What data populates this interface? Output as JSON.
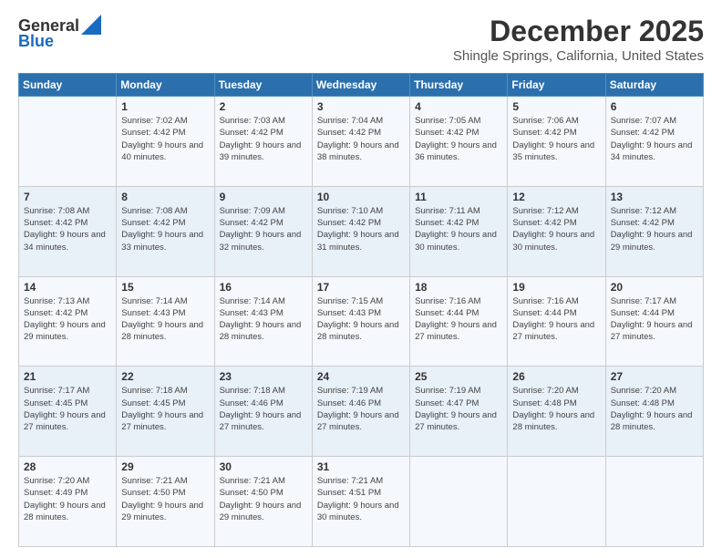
{
  "header": {
    "logo_general": "General",
    "logo_blue": "Blue",
    "main_title": "December 2025",
    "subtitle": "Shingle Springs, California, United States"
  },
  "calendar": {
    "days_of_week": [
      "Sunday",
      "Monday",
      "Tuesday",
      "Wednesday",
      "Thursday",
      "Friday",
      "Saturday"
    ],
    "weeks": [
      [
        {
          "day": "",
          "sunrise": "",
          "sunset": "",
          "daylight": ""
        },
        {
          "day": "1",
          "sunrise": "Sunrise: 7:02 AM",
          "sunset": "Sunset: 4:42 PM",
          "daylight": "Daylight: 9 hours and 40 minutes."
        },
        {
          "day": "2",
          "sunrise": "Sunrise: 7:03 AM",
          "sunset": "Sunset: 4:42 PM",
          "daylight": "Daylight: 9 hours and 39 minutes."
        },
        {
          "day": "3",
          "sunrise": "Sunrise: 7:04 AM",
          "sunset": "Sunset: 4:42 PM",
          "daylight": "Daylight: 9 hours and 38 minutes."
        },
        {
          "day": "4",
          "sunrise": "Sunrise: 7:05 AM",
          "sunset": "Sunset: 4:42 PM",
          "daylight": "Daylight: 9 hours and 36 minutes."
        },
        {
          "day": "5",
          "sunrise": "Sunrise: 7:06 AM",
          "sunset": "Sunset: 4:42 PM",
          "daylight": "Daylight: 9 hours and 35 minutes."
        },
        {
          "day": "6",
          "sunrise": "Sunrise: 7:07 AM",
          "sunset": "Sunset: 4:42 PM",
          "daylight": "Daylight: 9 hours and 34 minutes."
        }
      ],
      [
        {
          "day": "7",
          "sunrise": "Sunrise: 7:08 AM",
          "sunset": "Sunset: 4:42 PM",
          "daylight": "Daylight: 9 hours and 34 minutes."
        },
        {
          "day": "8",
          "sunrise": "Sunrise: 7:08 AM",
          "sunset": "Sunset: 4:42 PM",
          "daylight": "Daylight: 9 hours and 33 minutes."
        },
        {
          "day": "9",
          "sunrise": "Sunrise: 7:09 AM",
          "sunset": "Sunset: 4:42 PM",
          "daylight": "Daylight: 9 hours and 32 minutes."
        },
        {
          "day": "10",
          "sunrise": "Sunrise: 7:10 AM",
          "sunset": "Sunset: 4:42 PM",
          "daylight": "Daylight: 9 hours and 31 minutes."
        },
        {
          "day": "11",
          "sunrise": "Sunrise: 7:11 AM",
          "sunset": "Sunset: 4:42 PM",
          "daylight": "Daylight: 9 hours and 30 minutes."
        },
        {
          "day": "12",
          "sunrise": "Sunrise: 7:12 AM",
          "sunset": "Sunset: 4:42 PM",
          "daylight": "Daylight: 9 hours and 30 minutes."
        },
        {
          "day": "13",
          "sunrise": "Sunrise: 7:12 AM",
          "sunset": "Sunset: 4:42 PM",
          "daylight": "Daylight: 9 hours and 29 minutes."
        }
      ],
      [
        {
          "day": "14",
          "sunrise": "Sunrise: 7:13 AM",
          "sunset": "Sunset: 4:42 PM",
          "daylight": "Daylight: 9 hours and 29 minutes."
        },
        {
          "day": "15",
          "sunrise": "Sunrise: 7:14 AM",
          "sunset": "Sunset: 4:43 PM",
          "daylight": "Daylight: 9 hours and 28 minutes."
        },
        {
          "day": "16",
          "sunrise": "Sunrise: 7:14 AM",
          "sunset": "Sunset: 4:43 PM",
          "daylight": "Daylight: 9 hours and 28 minutes."
        },
        {
          "day": "17",
          "sunrise": "Sunrise: 7:15 AM",
          "sunset": "Sunset: 4:43 PM",
          "daylight": "Daylight: 9 hours and 28 minutes."
        },
        {
          "day": "18",
          "sunrise": "Sunrise: 7:16 AM",
          "sunset": "Sunset: 4:44 PM",
          "daylight": "Daylight: 9 hours and 27 minutes."
        },
        {
          "day": "19",
          "sunrise": "Sunrise: 7:16 AM",
          "sunset": "Sunset: 4:44 PM",
          "daylight": "Daylight: 9 hours and 27 minutes."
        },
        {
          "day": "20",
          "sunrise": "Sunrise: 7:17 AM",
          "sunset": "Sunset: 4:44 PM",
          "daylight": "Daylight: 9 hours and 27 minutes."
        }
      ],
      [
        {
          "day": "21",
          "sunrise": "Sunrise: 7:17 AM",
          "sunset": "Sunset: 4:45 PM",
          "daylight": "Daylight: 9 hours and 27 minutes."
        },
        {
          "day": "22",
          "sunrise": "Sunrise: 7:18 AM",
          "sunset": "Sunset: 4:45 PM",
          "daylight": "Daylight: 9 hours and 27 minutes."
        },
        {
          "day": "23",
          "sunrise": "Sunrise: 7:18 AM",
          "sunset": "Sunset: 4:46 PM",
          "daylight": "Daylight: 9 hours and 27 minutes."
        },
        {
          "day": "24",
          "sunrise": "Sunrise: 7:19 AM",
          "sunset": "Sunset: 4:46 PM",
          "daylight": "Daylight: 9 hours and 27 minutes."
        },
        {
          "day": "25",
          "sunrise": "Sunrise: 7:19 AM",
          "sunset": "Sunset: 4:47 PM",
          "daylight": "Daylight: 9 hours and 27 minutes."
        },
        {
          "day": "26",
          "sunrise": "Sunrise: 7:20 AM",
          "sunset": "Sunset: 4:48 PM",
          "daylight": "Daylight: 9 hours and 28 minutes."
        },
        {
          "day": "27",
          "sunrise": "Sunrise: 7:20 AM",
          "sunset": "Sunset: 4:48 PM",
          "daylight": "Daylight: 9 hours and 28 minutes."
        }
      ],
      [
        {
          "day": "28",
          "sunrise": "Sunrise: 7:20 AM",
          "sunset": "Sunset: 4:49 PM",
          "daylight": "Daylight: 9 hours and 28 minutes."
        },
        {
          "day": "29",
          "sunrise": "Sunrise: 7:21 AM",
          "sunset": "Sunset: 4:50 PM",
          "daylight": "Daylight: 9 hours and 29 minutes."
        },
        {
          "day": "30",
          "sunrise": "Sunrise: 7:21 AM",
          "sunset": "Sunset: 4:50 PM",
          "daylight": "Daylight: 9 hours and 29 minutes."
        },
        {
          "day": "31",
          "sunrise": "Sunrise: 7:21 AM",
          "sunset": "Sunset: 4:51 PM",
          "daylight": "Daylight: 9 hours and 30 minutes."
        },
        {
          "day": "",
          "sunrise": "",
          "sunset": "",
          "daylight": ""
        },
        {
          "day": "",
          "sunrise": "",
          "sunset": "",
          "daylight": ""
        },
        {
          "day": "",
          "sunrise": "",
          "sunset": "",
          "daylight": ""
        }
      ]
    ]
  }
}
